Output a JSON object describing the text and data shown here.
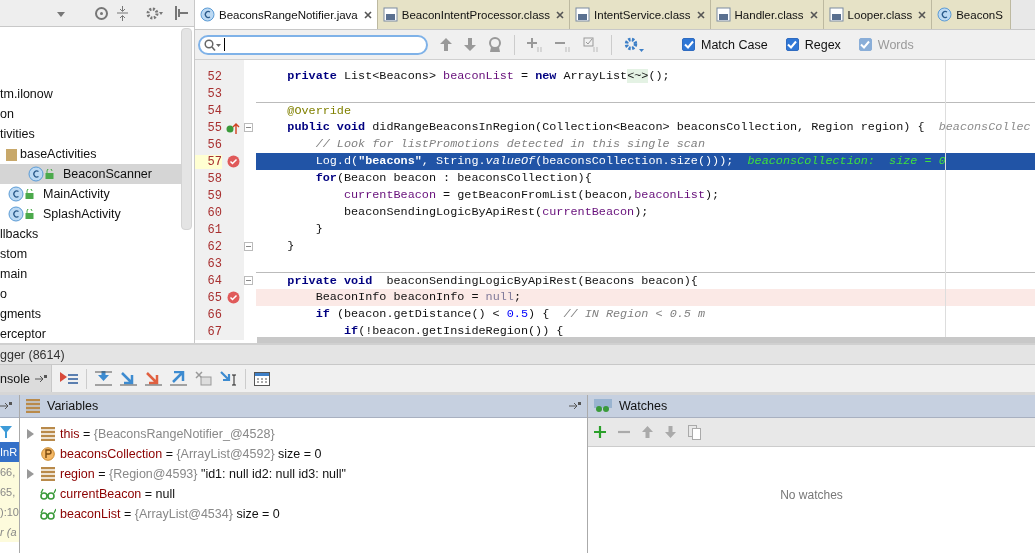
{
  "project_tree": {
    "items": [
      {
        "label": "tm.ilonow",
        "selected": false
      },
      {
        "label": "on",
        "selected": false
      },
      {
        "label": "tivities",
        "selected": false,
        "children": [
          {
            "label": "baseActivities",
            "kind": "folder",
            "selected": false,
            "children": [
              {
                "label": "BeaconScanner",
                "kind": "class",
                "selected": true
              }
            ]
          },
          {
            "label": "MainActivity",
            "kind": "class",
            "selected": false
          },
          {
            "label": "SplashActivity",
            "kind": "class",
            "selected": false
          }
        ]
      },
      {
        "label": "llbacks",
        "selected": false
      },
      {
        "label": "stom",
        "selected": false
      },
      {
        "label": "main",
        "selected": false
      },
      {
        "label": "o",
        "selected": false
      },
      {
        "label": "gments",
        "selected": false
      },
      {
        "label": "erceptor",
        "selected": false
      }
    ]
  },
  "editor_tabs": [
    {
      "label": "BeaconsRangeNotifier.java",
      "kind": "java",
      "selected": true,
      "closable": true
    },
    {
      "label": "BeaconIntentProcessor.class",
      "kind": "class",
      "selected": false,
      "closable": true
    },
    {
      "label": "IntentService.class",
      "kind": "class",
      "selected": false,
      "closable": true
    },
    {
      "label": "Handler.class",
      "kind": "class",
      "selected": false,
      "closable": true
    },
    {
      "label": "Looper.class",
      "kind": "class",
      "selected": false,
      "closable": true
    },
    {
      "label": "BeaconS",
      "kind": "java",
      "selected": false,
      "closable": false
    }
  ],
  "find_bar": {
    "options": [
      {
        "label": "Match Case",
        "checked": true,
        "disabled": false
      },
      {
        "label": "Regex",
        "checked": true,
        "disabled": false
      },
      {
        "label": "Words",
        "checked": true,
        "disabled": true
      }
    ]
  },
  "code_lines": [
    {
      "number": "52",
      "kind": "normal",
      "breakpoint": false,
      "override": false,
      "fold": false,
      "separator": false,
      "segments": [
        {
          "text": "    private",
          "kind": "kw"
        },
        {
          "text": " List<Beacons> ",
          "kind": "plain"
        },
        {
          "text": "beaconList",
          "kind": "field"
        },
        {
          "text": " = ",
          "kind": "plain"
        },
        {
          "text": "new",
          "kind": "kw"
        },
        {
          "text": " ArrayList",
          "kind": "plain"
        },
        {
          "text": "<~>",
          "kind": "fold"
        },
        {
          "text": "();",
          "kind": "plain"
        }
      ]
    },
    {
      "number": "53",
      "kind": "normal",
      "breakpoint": false,
      "override": false,
      "fold": false,
      "separator": false
    },
    {
      "number": "54",
      "kind": "normal",
      "breakpoint": false,
      "override": false,
      "fold": false,
      "separator": true,
      "segments": [
        {
          "text": "    @Override",
          "kind": "ann"
        }
      ]
    },
    {
      "number": "55",
      "kind": "normal",
      "breakpoint": false,
      "override": true,
      "fold": true,
      "separator": false,
      "segments": [
        {
          "text": "    public void",
          "kind": "kw"
        },
        {
          "text": " didRangeBeaconsInRegion(Collection<Beacon> beaconsCollection, Region region) {  ",
          "kind": "plain"
        },
        {
          "text": "beaconsCollec",
          "kind": "hint"
        }
      ]
    },
    {
      "number": "56",
      "kind": "normal",
      "breakpoint": false,
      "override": false,
      "fold": false,
      "separator": false,
      "segments": [
        {
          "text": "        // Look for listPromotions detected in this single scan",
          "kind": "comment"
        }
      ]
    },
    {
      "number": "57",
      "kind": "current",
      "breakpoint": true,
      "override": false,
      "fold": false,
      "separator": false,
      "segments": [
        {
          "text": "        Log.d(",
          "kind": "plain"
        },
        {
          "text": "\"beacons\"",
          "kind": "str"
        },
        {
          "text": ", String.",
          "kind": "plain"
        },
        {
          "text": "valueOf",
          "kind": "italic"
        },
        {
          "text": "(beaconsCollection.size()));  ",
          "kind": "plain"
        },
        {
          "text": "beaconsCollection:  size = 0",
          "kind": "inlay"
        }
      ]
    },
    {
      "number": "58",
      "kind": "normal",
      "breakpoint": false,
      "override": false,
      "fold": false,
      "separator": false,
      "segments": [
        {
          "text": "        for",
          "kind": "kw"
        },
        {
          "text": "(Beacon beacon : beaconsCollection){",
          "kind": "plain"
        }
      ]
    },
    {
      "number": "59",
      "kind": "normal",
      "breakpoint": false,
      "override": false,
      "fold": false,
      "separator": false,
      "segments": [
        {
          "text": "            currentBeacon",
          "kind": "field"
        },
        {
          "text": " = getBeaconFromList(beacon,",
          "kind": "plain"
        },
        {
          "text": "beaconList",
          "kind": "field"
        },
        {
          "text": ");",
          "kind": "plain"
        }
      ]
    },
    {
      "number": "60",
      "kind": "normal",
      "breakpoint": false,
      "override": false,
      "fold": false,
      "separator": false,
      "segments": [
        {
          "text": "            beaconSendingLogicByApiRest(",
          "kind": "plain"
        },
        {
          "text": "currentBeacon",
          "kind": "field"
        },
        {
          "text": ");",
          "kind": "plain"
        }
      ]
    },
    {
      "number": "61",
      "kind": "normal",
      "breakpoint": false,
      "override": false,
      "fold": false,
      "separator": false,
      "segments": [
        {
          "text": "        }",
          "kind": "plain"
        }
      ]
    },
    {
      "number": "62",
      "kind": "normal",
      "breakpoint": false,
      "override": false,
      "fold": true,
      "separator": false,
      "segments": [
        {
          "text": "    }",
          "kind": "plain"
        }
      ]
    },
    {
      "number": "63",
      "kind": "normal",
      "breakpoint": false,
      "override": false,
      "fold": false,
      "separator": false
    },
    {
      "number": "64",
      "kind": "normal",
      "breakpoint": false,
      "override": false,
      "fold": true,
      "separator": true,
      "segments": [
        {
          "text": "    private void",
          "kind": "kw"
        },
        {
          "text": "  beaconSendingLogicByApiRest(Beacons beacon){",
          "kind": "plain"
        }
      ]
    },
    {
      "number": "65",
      "kind": "breakpoint",
      "breakpoint": true,
      "override": false,
      "fold": false,
      "separator": false,
      "segments": [
        {
          "text": "        BeaconInfo beaconInfo = ",
          "kind": "plain"
        },
        {
          "text": "null",
          "kind": "literal"
        },
        {
          "text": ";",
          "kind": "plain"
        }
      ]
    },
    {
      "number": "66",
      "kind": "normal",
      "breakpoint": false,
      "override": false,
      "fold": false,
      "separator": false,
      "segments": [
        {
          "text": "        if",
          "kind": "kw"
        },
        {
          "text": " (beacon.getDistance() < ",
          "kind": "plain"
        },
        {
          "text": "0.5",
          "kind": "num"
        },
        {
          "text": ") {  ",
          "kind": "plain"
        },
        {
          "text": "// IN Region < 0.5 m",
          "kind": "comment"
        }
      ]
    },
    {
      "number": "67",
      "kind": "normal",
      "breakpoint": false,
      "override": false,
      "fold": false,
      "separator": false,
      "segments": [
        {
          "text": "            if",
          "kind": "kw"
        },
        {
          "text": "(!beacon.getInsideRegion()) {",
          "kind": "plain"
        }
      ]
    }
  ],
  "debug": {
    "title": "gger (8614)",
    "console_tab": "nsole",
    "frames": [
      {
        "label": "InR",
        "selected": true
      },
      {
        "label": "66,",
        "selected": false
      },
      {
        "label": "65,",
        "selected": false
      },
      {
        "label": "):10",
        "selected": false
      },
      {
        "label": "r (a",
        "selected": false
      }
    ],
    "variables": {
      "title": "Variables",
      "rows": [
        {
          "name": "this",
          "kind": "field",
          "expandable": true,
          "equals": "=",
          "ref": "{BeaconsRangeNotifier_@4528}"
        },
        {
          "name": "beaconsCollection",
          "kind": "param",
          "expandable": false,
          "equals": "=",
          "ref": "{ArrayList@4592}",
          "extra": "size = 0"
        },
        {
          "name": "region",
          "kind": "field",
          "expandable": true,
          "equals": "=",
          "ref": "{Region@4593}",
          "extra": "\"id1: null id2: null id3: null\""
        },
        {
          "name": "currentBeacon",
          "kind": "watch",
          "expandable": false,
          "equals": "=",
          "extra": "null"
        },
        {
          "name": "beaconList",
          "kind": "watch",
          "expandable": false,
          "equals": "=",
          "ref": "{ArrayList@4534}",
          "extra": "size = 0"
        }
      ]
    },
    "watches": {
      "title": "Watches",
      "empty_text": "No watches"
    }
  }
}
